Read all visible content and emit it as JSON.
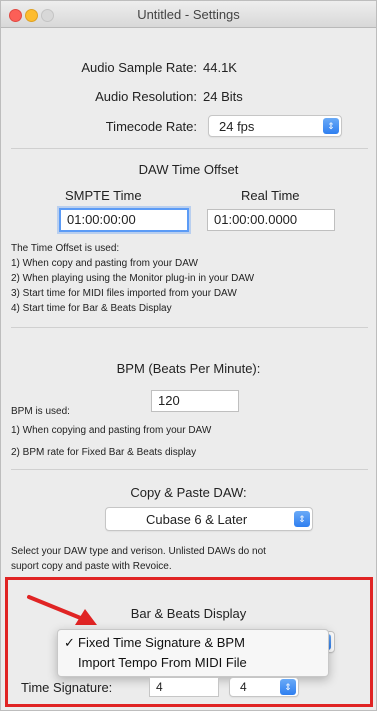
{
  "window": {
    "title": "Untitled - Settings"
  },
  "general": {
    "sample_rate_label": "Audio Sample Rate:",
    "sample_rate_value": "44.1K",
    "resolution_label": "Audio Resolution:",
    "resolution_value": "24 Bits",
    "timecode_label": "Timecode Rate:",
    "timecode_value": "24 fps"
  },
  "daw_offset": {
    "title": "DAW Time Offset",
    "smpte_header": "SMPTE Time",
    "real_header": "Real Time",
    "smpte_value": "01:00:00:00",
    "real_value": "01:00:00.0000",
    "notes": [
      "The Time Offset is used:",
      "1) When copy and pasting from your DAW",
      "2) When playing using the Monitor plug-in in your DAW",
      "3) Start time for MIDI files imported from your DAW",
      "4) Start time for Bar & Beats Display"
    ]
  },
  "bpm": {
    "title": "BPM (Beats Per Minute):",
    "value": "120",
    "notes": [
      "BPM is used:",
      "1) When copying and pasting from your DAW",
      "2) BPM rate for Fixed Bar & Beats display"
    ]
  },
  "copy_paste": {
    "title": "Copy & Paste DAW:",
    "value": "Cubase 6 & Later",
    "note_line1": "Select your DAW type and verison. Unlisted DAWs do not",
    "note_line2": "suport copy and paste with Revoice."
  },
  "bar_beats": {
    "title": "Bar & Beats Display",
    "menu_options": [
      {
        "label": "Fixed Time Signature & BPM",
        "checked": "✓"
      },
      {
        "label": "Import Tempo From MIDI File",
        "checked": ""
      }
    ],
    "time_sig_label": "Time Signature:",
    "time_sig_top": "4",
    "time_sig_bottom": "4"
  },
  "colors": {
    "highlight": "#e02424",
    "accent": "#2f7ff0"
  }
}
